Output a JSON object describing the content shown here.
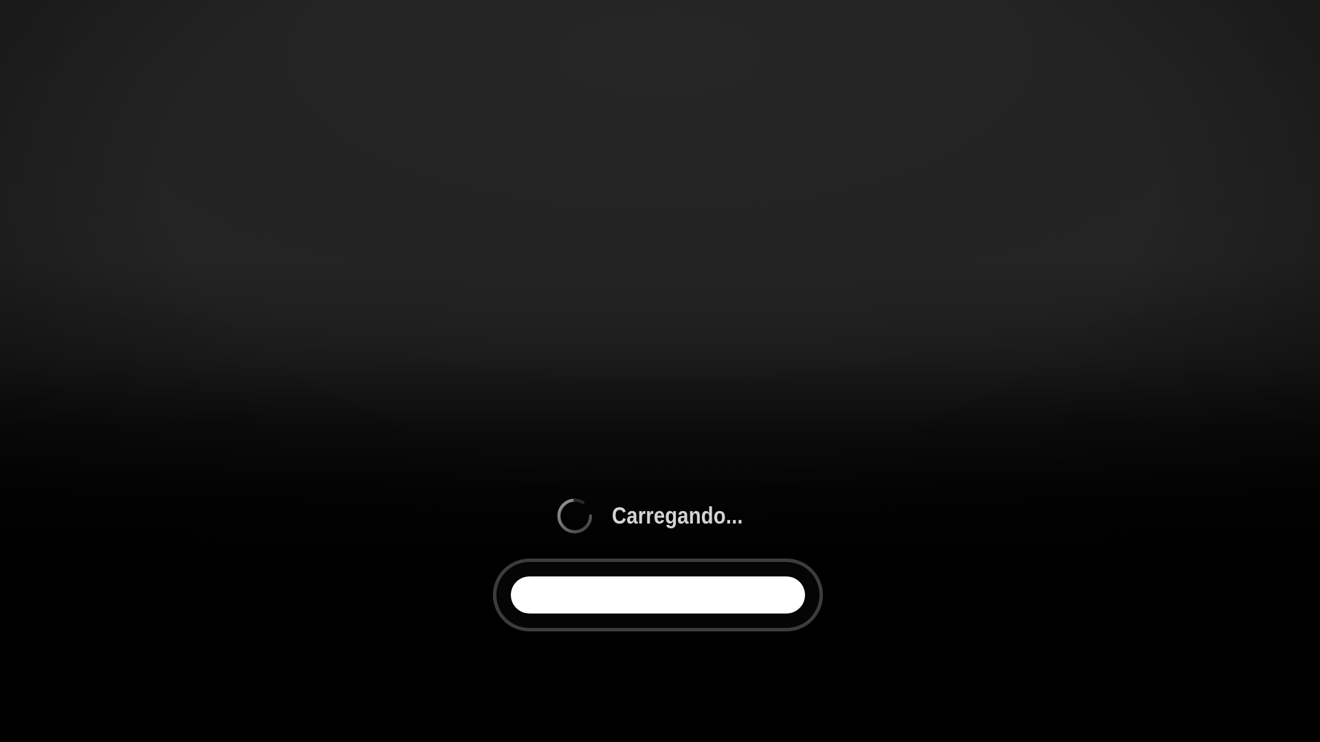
{
  "screen": {
    "background": "#000000"
  },
  "loading": {
    "text": "Carregando...",
    "spinner_icon": "loading-spinner-icon",
    "text_color": "#d4d4d4"
  },
  "progress": {
    "value": 1.0,
    "fill_color": "#ffffff",
    "track_border_color": "#3c3c3c"
  }
}
